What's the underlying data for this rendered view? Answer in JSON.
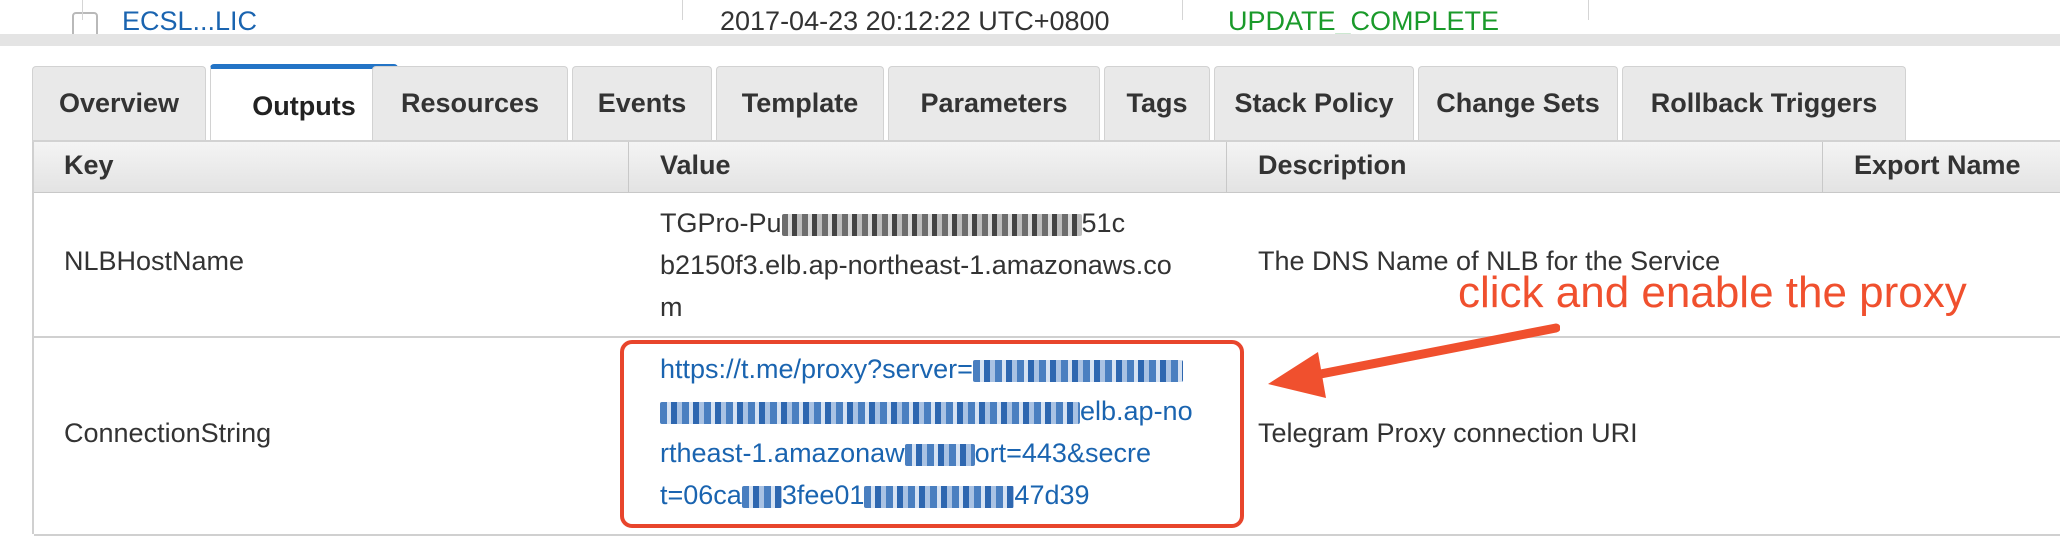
{
  "top_row": {
    "stack_name": "ECSL...LIC",
    "time": "2017-04-23 20:12:22 UTC+0800",
    "status": "UPDATE_COMPLETE"
  },
  "tabs": [
    {
      "label": "Overview",
      "active": false
    },
    {
      "label": "Outputs",
      "active": true
    },
    {
      "label": "Resources",
      "active": false
    },
    {
      "label": "Events",
      "active": false
    },
    {
      "label": "Template",
      "active": false
    },
    {
      "label": "Parameters",
      "active": false
    },
    {
      "label": "Tags",
      "active": false
    },
    {
      "label": "Stack Policy",
      "active": false
    },
    {
      "label": "Change Sets",
      "active": false
    },
    {
      "label": "Rollback Triggers",
      "active": false
    }
  ],
  "table": {
    "headers": {
      "key": "Key",
      "value": "Value",
      "description": "Description",
      "export_name": "Export Name"
    },
    "rows": [
      {
        "key": "NLBHostName",
        "value_lines": [
          "TGPro-Pu",
          "51c",
          "b2150f3.elb.ap-northeast-1.amazonaws.co",
          "m"
        ],
        "description": "The DNS Name of NLB for the Service"
      },
      {
        "key": "ConnectionString",
        "value_lines": [
          "https://t.me/proxy?server=",
          "elb.ap-no",
          "rtheast-1.amazonaw",
          "ort=443&secre",
          "t=06ca",
          "3fee01",
          "47d39"
        ],
        "description": "Telegram Proxy connection URI"
      }
    ]
  },
  "annotation": {
    "text": "click and enable the proxy",
    "color": "#f0502e"
  },
  "colors": {
    "active_tab_accent": "#2374c6",
    "link": "#1a64b0",
    "status_green": "#1a9a2a",
    "highlight": "#e8452c"
  }
}
